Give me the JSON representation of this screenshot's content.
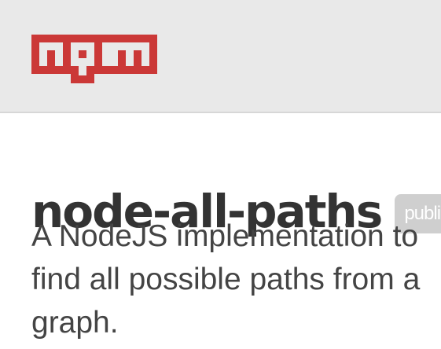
{
  "header": {
    "logo_text": "npm",
    "brand_color": "#cb3837",
    "background_color": "#e9e9e9"
  },
  "package": {
    "name": "node-all-paths",
    "visibility": "public",
    "description": "A NodeJS implementation to find all possible paths from a graph."
  }
}
